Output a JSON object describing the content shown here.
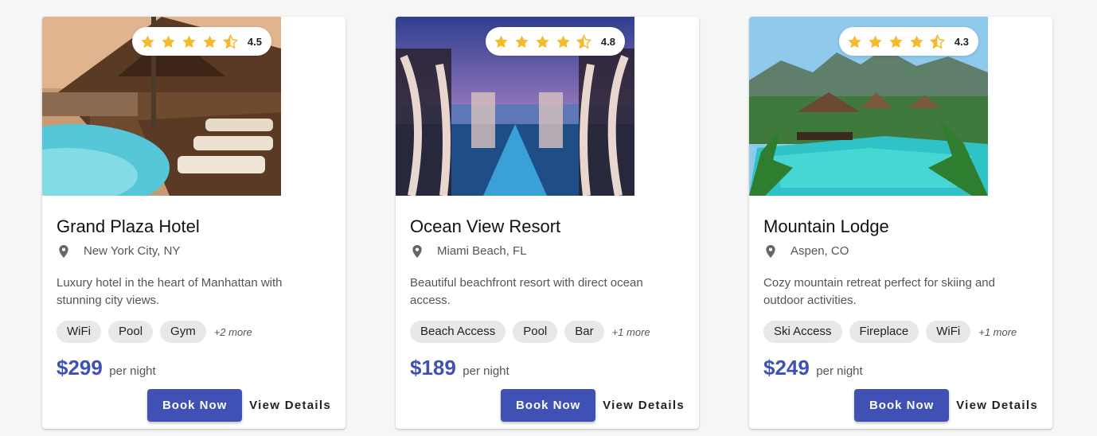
{
  "colors": {
    "primary": "#3f51b5",
    "star": "#f6b92b",
    "chip": "#e8e8e8"
  },
  "icons": {
    "star": "star-icon",
    "half_star": "star-half-icon",
    "location": "location-pin-icon"
  },
  "hotels": [
    {
      "name": "Grand Plaza Hotel",
      "location": "New York City, NY",
      "description": "Luxury hotel in the heart of Manhattan with stunning city views.",
      "rating": "4.5",
      "amenities": [
        "WiFi",
        "Pool",
        "Gym"
      ],
      "more": "+2 more",
      "price": "$299",
      "price_unit": "per night",
      "book_label": "Book Now",
      "details_label": "View Details"
    },
    {
      "name": "Ocean View Resort",
      "location": "Miami Beach, FL",
      "description": "Beautiful beachfront resort with direct ocean access.",
      "rating": "4.8",
      "amenities": [
        "Beach Access",
        "Pool",
        "Bar"
      ],
      "more": "+1 more",
      "price": "$189",
      "price_unit": "per night",
      "book_label": "Book Now",
      "details_label": "View Details"
    },
    {
      "name": "Mountain Lodge",
      "location": "Aspen, CO",
      "description": "Cozy mountain retreat perfect for skiing and outdoor activities.",
      "rating": "4.3",
      "amenities": [
        "Ski Access",
        "Fireplace",
        "WiFi"
      ],
      "more": "+1 more",
      "price": "$249",
      "price_unit": "per night",
      "book_label": "Book Now",
      "details_label": "View Details"
    }
  ]
}
